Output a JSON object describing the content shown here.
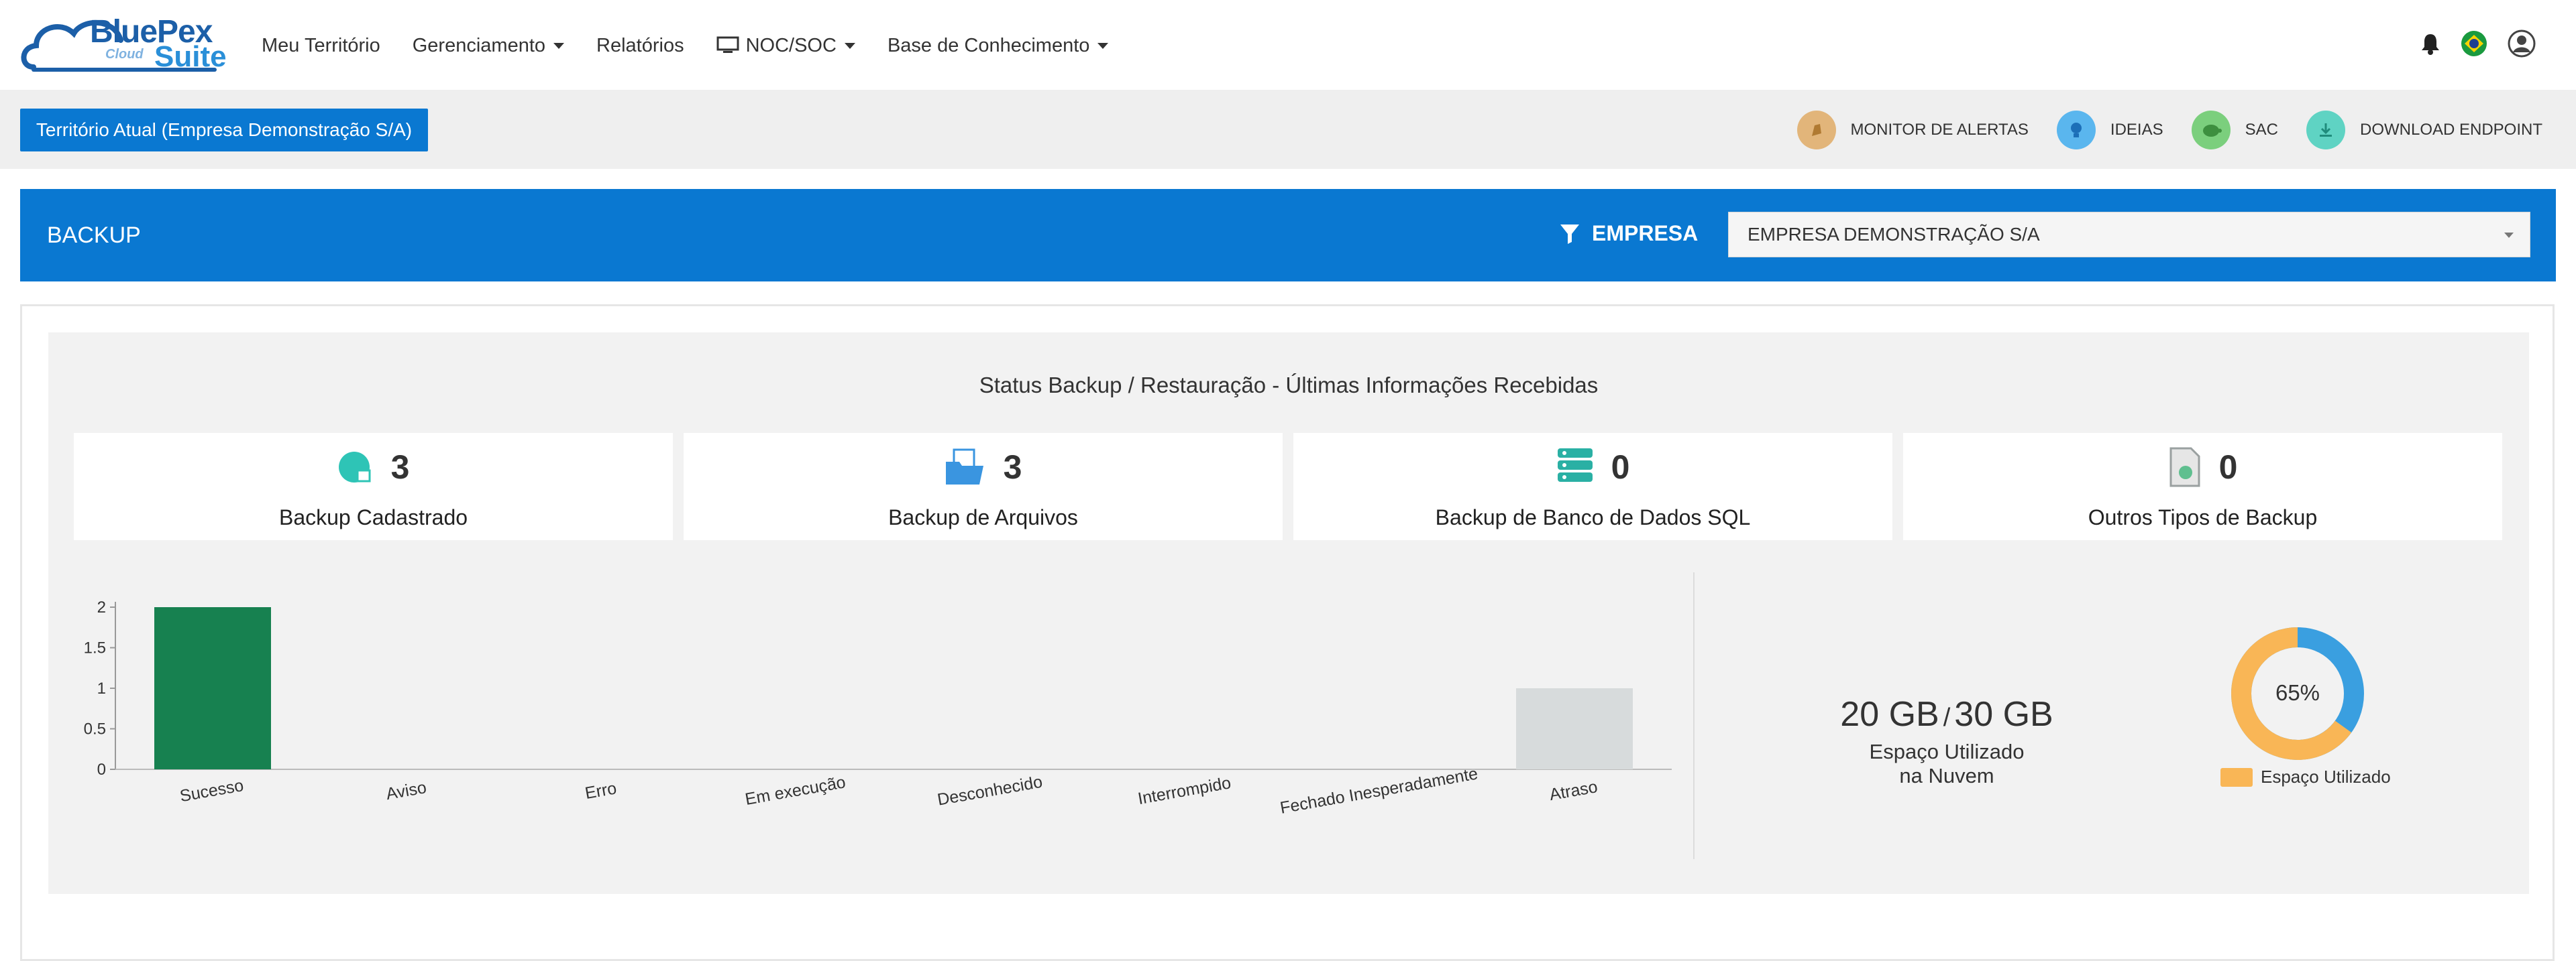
{
  "navbar": {
    "logo": {
      "brand": "BluePex",
      "cloud": "Cloud",
      "suite": "Suite"
    },
    "menu": [
      {
        "label": "Meu Território",
        "dropdown": false
      },
      {
        "label": "Gerenciamento",
        "dropdown": true
      },
      {
        "label": "Relatórios",
        "dropdown": false
      },
      {
        "label": "NOC/SOC",
        "dropdown": true,
        "icon": "monitor-icon"
      },
      {
        "label": "Base de Conhecimento",
        "dropdown": true
      }
    ],
    "right_icons": [
      "bell-icon",
      "brazil-flag-icon",
      "user-avatar-icon"
    ]
  },
  "territory": {
    "current_label": "Território Atual (Empresa Demonstração S/A)",
    "quick_links": [
      {
        "label": "MONITOR DE ALERTAS",
        "icon": "alert-monitor-icon",
        "color": "#e2b57a"
      },
      {
        "label": "IDEIAS",
        "icon": "lightbulb-icon",
        "color": "#5ab6ee"
      },
      {
        "label": "SAC",
        "icon": "turtle-icon",
        "color": "#7bcf7d"
      },
      {
        "label": "DOWNLOAD ENDPOINT",
        "icon": "download-icon",
        "color": "#5fd3c3"
      }
    ]
  },
  "header": {
    "title": "BACKUP",
    "filter_label": "EMPRESA",
    "company_select": "EMPRESA DEMONSTRAÇÃO S/A",
    "accent_color": "#0a78d1"
  },
  "status": {
    "title": "Status Backup / Restauração - Últimas Informações Recebidas",
    "cards": [
      {
        "count": "3",
        "label": "Backup Cadastrado",
        "icon": "backup-registered-icon"
      },
      {
        "count": "3",
        "label": "Backup de Arquivos",
        "icon": "file-folder-icon"
      },
      {
        "count": "0",
        "label": "Backup de Banco de Dados SQL",
        "icon": "database-icon"
      },
      {
        "count": "0",
        "label": "Outros Tipos de Backup",
        "icon": "other-file-icon"
      }
    ]
  },
  "chart_data": {
    "type": "bar",
    "categories": [
      "Sucesso",
      "Aviso",
      "Erro",
      "Em execução",
      "Desconhecido",
      "Interrompido",
      "Fechado Inesperadamente",
      "Atraso"
    ],
    "values": [
      2,
      0,
      0,
      0,
      0,
      0,
      0,
      1
    ],
    "colors": [
      "#178150",
      "#178150",
      "#178150",
      "#178150",
      "#178150",
      "#178150",
      "#178150",
      "#d7dbdc"
    ],
    "yticks": [
      "0",
      "0.5",
      "1",
      "1.5",
      "2"
    ],
    "ylim": [
      0,
      2
    ],
    "grid": false
  },
  "storage": {
    "used": "20 GB",
    "separator": "/",
    "total": "30 GB",
    "label_line1": "Espaço Utilizado",
    "label_line2": "na Nuvem",
    "percent_label": "65%",
    "percent_value": 65,
    "legend_label": "Espaço Utilizado",
    "used_color": "#f9b656",
    "free_color": "#3a9fe0"
  }
}
